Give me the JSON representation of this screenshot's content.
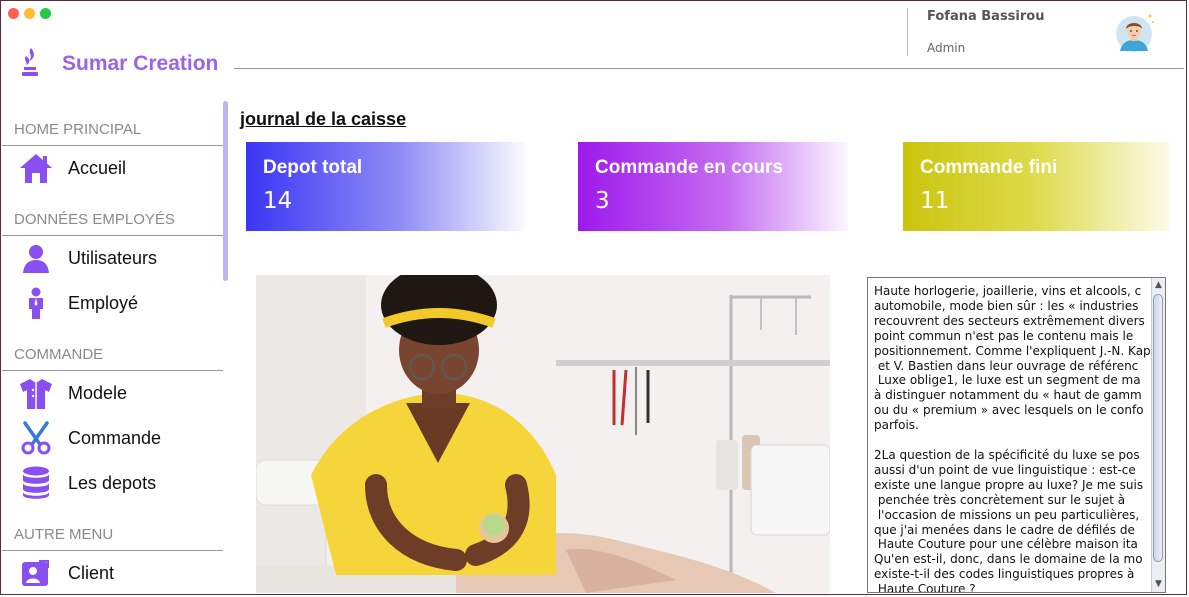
{
  "app": {
    "brand": "Sumar Creation"
  },
  "user": {
    "name": "Fofana Bassirou",
    "role": "Admin"
  },
  "sidebar": {
    "sections": [
      {
        "title": "HOME PRINCIPAL",
        "items": [
          {
            "label": "Accueil",
            "icon": "home-icon"
          }
        ]
      },
      {
        "title": "DONNÉES EMPLOYÉS",
        "items": [
          {
            "label": "Utilisateurs",
            "icon": "user-icon"
          },
          {
            "label": "Employé",
            "icon": "employee-icon"
          }
        ]
      },
      {
        "title": "COMMANDE",
        "items": [
          {
            "label": "Modele",
            "icon": "shirt-icon"
          },
          {
            "label": "Commande",
            "icon": "scissors-icon"
          },
          {
            "label": "Les depots",
            "icon": "database-icon"
          }
        ]
      },
      {
        "title": "AUTRE MENU",
        "items": [
          {
            "label": "Client",
            "icon": "client-icon"
          }
        ]
      }
    ]
  },
  "main": {
    "title": "journal de la caisse",
    "cards": [
      {
        "title": "Depot total",
        "value": "14",
        "color": "#3b35f5"
      },
      {
        "title": "Commande en cours",
        "value": "3",
        "color": "#9e18ec"
      },
      {
        "title": "Commande fini",
        "value": "11",
        "color": "#c9c50d"
      }
    ],
    "article": "Haute horlogerie, joaillerie, vins et alcools, c\nautomobile, mode bien sûr : les « industries\nrecouvrent des secteurs extrêmement divers\npoint commun n'est pas le contenu mais le\npositionnement. Comme l'expliquent J.-N. Kap\n et V. Bastien dans leur ouvrage de référenc\n Luxe oblige1, le luxe est un segment de ma\nà distinguer notamment du « haut de gamm\nou du « premium » avec lesquels on le confo\nparfois.\n\n2La question de la spécificité du luxe se pos\naussi d'un point de vue linguistique : est-ce\nexiste une langue propre au luxe? Je me suis\n penchée très concrètement sur le sujet à\n l'occasion de missions un peu particulières,\nque j'ai menées dans le cadre de défilés de\n Haute Couture pour une célèbre maison ita\nQu'en est-il, donc, dans le domaine de la mo\nexiste-t-il des codes linguistiques propres à\n Haute Couture ?"
  },
  "colors": {
    "accent": "#9a63e8",
    "icon": "#8a4ff0"
  }
}
